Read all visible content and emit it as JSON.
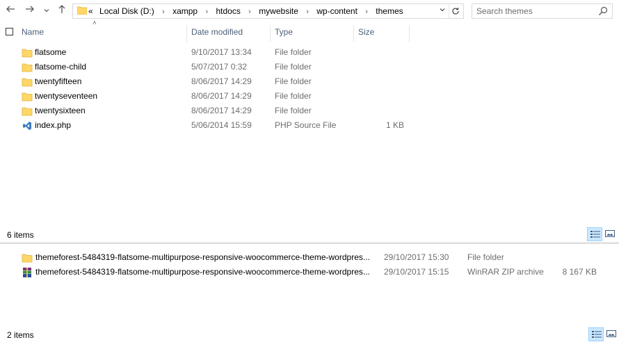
{
  "nav": {
    "back_icon": "arrow-left-icon",
    "forward_icon": "arrow-right-icon",
    "recent_icon": "chevron-down-icon",
    "up_icon": "arrow-up-icon"
  },
  "address": {
    "overflow": "«",
    "crumbs": [
      "Local Disk (D:)",
      "xampp",
      "htdocs",
      "mywebsite",
      "wp-content",
      "themes"
    ],
    "separator": "›"
  },
  "search": {
    "placeholder": "Search themes"
  },
  "columns": {
    "name": "Name",
    "date": "Date modified",
    "type": "Type",
    "size": "Size"
  },
  "pane1": {
    "files": [
      {
        "name": "flatsome",
        "date": "9/10/2017 13:34",
        "type": "File folder",
        "size": "",
        "icon": "folder-icon"
      },
      {
        "name": "flatsome-child",
        "date": "5/07/2017 0:32",
        "type": "File folder",
        "size": "",
        "icon": "folder-icon"
      },
      {
        "name": "twentyfifteen",
        "date": "8/06/2017 14:29",
        "type": "File folder",
        "size": "",
        "icon": "folder-icon"
      },
      {
        "name": "twentyseventeen",
        "date": "8/06/2017 14:29",
        "type": "File folder",
        "size": "",
        "icon": "folder-icon"
      },
      {
        "name": "twentysixteen",
        "date": "8/06/2017 14:29",
        "type": "File folder",
        "size": "",
        "icon": "folder-icon"
      },
      {
        "name": "index.php",
        "date": "5/06/2014 15:59",
        "type": "PHP Source File",
        "size": "1 KB",
        "icon": "php-file-icon"
      }
    ],
    "status": "6 items"
  },
  "pane2": {
    "files": [
      {
        "name": "themeforest-5484319-flatsome-multipurpose-responsive-woocommerce-theme-wordpres...",
        "date": "29/10/2017 15:30",
        "type": "File folder",
        "size": "",
        "icon": "folder-icon"
      },
      {
        "name": "themeforest-5484319-flatsome-multipurpose-responsive-woocommerce-theme-wordpres...",
        "date": "29/10/2017 15:15",
        "type": "WinRAR ZIP archive",
        "size": "8 167 KB",
        "icon": "winrar-archive-icon"
      }
    ],
    "status": "2 items"
  },
  "colors": {
    "header_text": "#4c607a",
    "folder": "#ffd767",
    "view_active": "#cce8ff"
  }
}
